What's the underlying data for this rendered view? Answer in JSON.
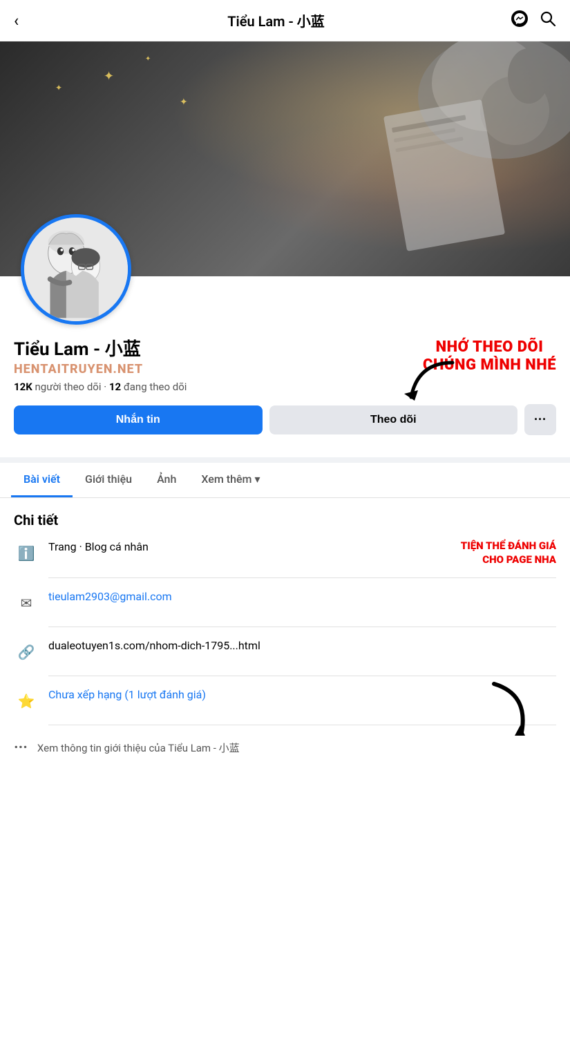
{
  "header": {
    "title": "Tiểu Lam - 小蓝",
    "back_label": "‹",
    "messenger_icon": "messenger",
    "search_icon": "search"
  },
  "profile": {
    "name": "Tiểu Lam - 小蓝",
    "watermark": "HENTAITRUYEN.NET",
    "followers_count": "12K",
    "followers_label": "người theo dõi",
    "following_count": "12",
    "following_label": "đang theo dõi",
    "overlay_text_line1": "NHỚ THEO DÕI",
    "overlay_text_line2": "CHÚNG MÌNH NHÉ"
  },
  "buttons": {
    "message": "Nhắn tin",
    "follow": "Theo dõi",
    "more": "···"
  },
  "tabs": [
    {
      "label": "Bài viết",
      "active": true
    },
    {
      "label": "Giới thiệu",
      "active": false
    },
    {
      "label": "Ảnh",
      "active": false
    },
    {
      "label": "Xem thêm",
      "active": false,
      "has_arrow": true
    }
  ],
  "details": {
    "title": "Chi tiết",
    "items": [
      {
        "icon": "ℹ",
        "text": "Trang · Blog cá nhân",
        "overlay": "TIỆN THỂ ĐÁNH GIÁ\nCHO PAGE NHA",
        "is_overlay": true
      },
      {
        "icon": "✉",
        "text": "tieulam2903@gmail.com",
        "is_link": true
      },
      {
        "icon": "🔗",
        "text": "dualeotuyen1s.com/nhom-dich-1795...html",
        "is_link": false
      },
      {
        "icon": "⭐",
        "text": "Chưa xếp hạng (1 lượt đánh giá)",
        "is_link": true,
        "has_big_arrow": true
      }
    ],
    "more_info_text": "Xem thông tin giới thiệu của Tiểu Lam - 小蓝"
  }
}
